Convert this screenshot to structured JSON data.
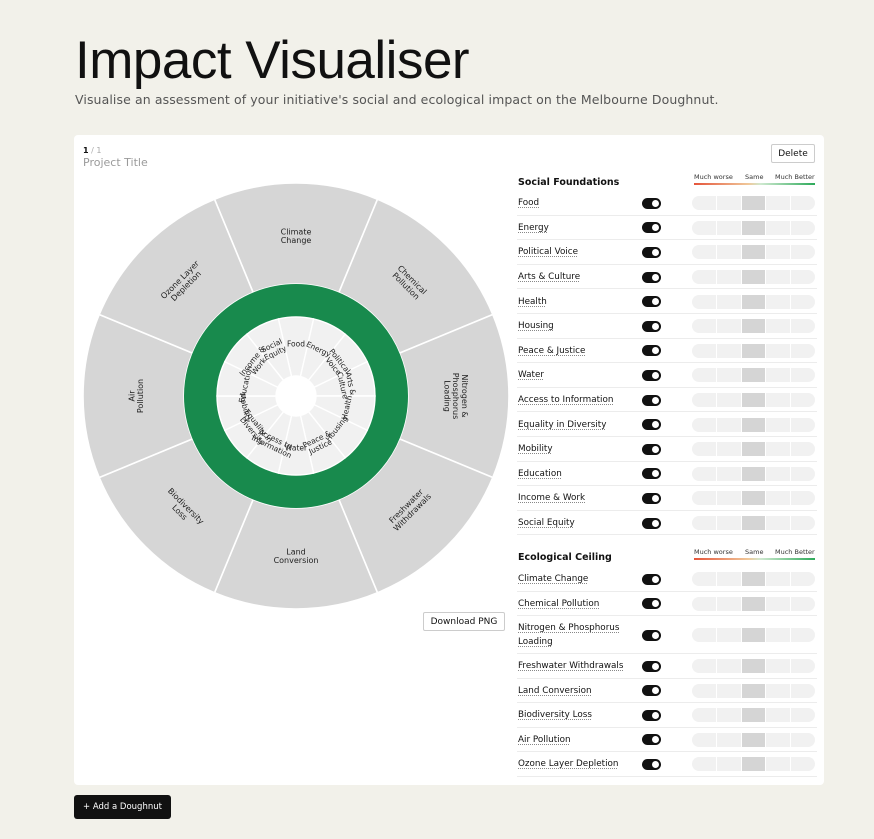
{
  "page": {
    "title": "Impact Visualiser",
    "subtitle": "Visualise an assessment of your initiative's social and ecological impact on the Melbourne Doughnut."
  },
  "card": {
    "page_current": "1",
    "page_total": " / 1",
    "project_title": "Project Title",
    "delete_label": "Delete",
    "download_label": "Download PNG"
  },
  "doughnut": {
    "ring_color": "#188a4d",
    "outer_color": "#d6d6d6",
    "inner_color": "#f1f1f1",
    "outer_labels": [
      "Climate Change",
      "Chemical Pollution",
      "Nitrogen & Phosphorus Loading",
      "Freshwater Withdrawals",
      "Land Conversion",
      "Biodiversity Loss",
      "Air Pollution",
      "Ozone Layer Depletion"
    ],
    "inner_labels": [
      "Food",
      "Energy",
      "Political Voice",
      "Arts & Culture",
      "Health",
      "Housing",
      "Peace & Justice",
      "Water",
      "Access to Information",
      "Equality in Diversity",
      "Mobility",
      "Education",
      "Income & Work",
      "Social Equity"
    ]
  },
  "scale": {
    "worse": "Much worse",
    "same": "Same",
    "better": "Much Better"
  },
  "social": {
    "title": "Social Foundations",
    "items": [
      {
        "label": "Food",
        "on": true,
        "rating": 2
      },
      {
        "label": "Energy",
        "on": true,
        "rating": 2
      },
      {
        "label": "Political Voice",
        "on": true,
        "rating": 2
      },
      {
        "label": "Arts & Culture",
        "on": true,
        "rating": 2
      },
      {
        "label": "Health",
        "on": true,
        "rating": 2
      },
      {
        "label": "Housing",
        "on": true,
        "rating": 2
      },
      {
        "label": "Peace & Justice",
        "on": true,
        "rating": 2
      },
      {
        "label": "Water",
        "on": true,
        "rating": 2
      },
      {
        "label": "Access to Information",
        "on": true,
        "rating": 2
      },
      {
        "label": "Equality in Diversity",
        "on": true,
        "rating": 2
      },
      {
        "label": "Mobility",
        "on": true,
        "rating": 2
      },
      {
        "label": "Education",
        "on": true,
        "rating": 2
      },
      {
        "label": "Income & Work",
        "on": true,
        "rating": 2
      },
      {
        "label": "Social Equity",
        "on": true,
        "rating": 2
      }
    ]
  },
  "ecological": {
    "title": "Ecological Ceiling",
    "items": [
      {
        "label": "Climate Change",
        "on": true,
        "rating": 2
      },
      {
        "label": "Chemical Pollution",
        "on": true,
        "rating": 2
      },
      {
        "label": "Nitrogen & Phosphorus Loading",
        "on": true,
        "rating": 2
      },
      {
        "label": "Freshwater Withdrawals",
        "on": true,
        "rating": 2
      },
      {
        "label": "Land Conversion",
        "on": true,
        "rating": 2
      },
      {
        "label": "Biodiversity Loss",
        "on": true,
        "rating": 2
      },
      {
        "label": "Air Pollution",
        "on": true,
        "rating": 2
      },
      {
        "label": "Ozone Layer Depletion",
        "on": true,
        "rating": 2
      }
    ]
  },
  "footer": {
    "add_label": "+ Add a Doughnut"
  }
}
